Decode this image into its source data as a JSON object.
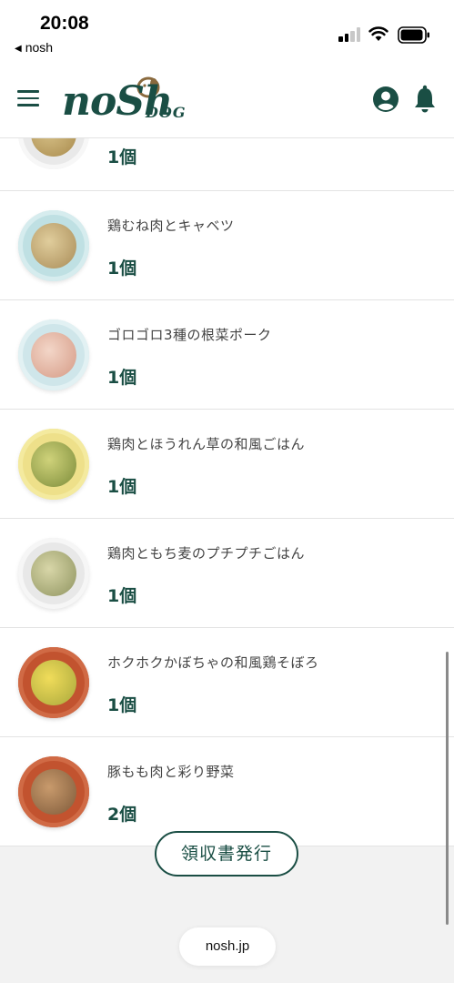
{
  "status_bar": {
    "time": "20:08",
    "back_app": "nosh"
  },
  "header": {
    "logo_main": "noSh",
    "logo_sub": "DOG"
  },
  "colors": {
    "brand_green": "#1a4e44",
    "background": "#f2f2f2"
  },
  "items": [
    {
      "name": "",
      "qty": "1個"
    },
    {
      "name": "鶏むね肉とキャベツ",
      "qty": "1個"
    },
    {
      "name": "ゴロゴロ3種の根菜ポーク",
      "qty": "1個"
    },
    {
      "name": "鶏肉とほうれん草の和風ごはん",
      "qty": "1個"
    },
    {
      "name": "鶏肉ともち麦のプチプチごはん",
      "qty": "1個"
    },
    {
      "name": "ホクホクかぼちゃの和風鶏そぼろ",
      "qty": "1個"
    },
    {
      "name": "豚もも肉と彩り野菜",
      "qty": "2個"
    }
  ],
  "receipt_button": "領収書発行",
  "url": "nosh.jp"
}
